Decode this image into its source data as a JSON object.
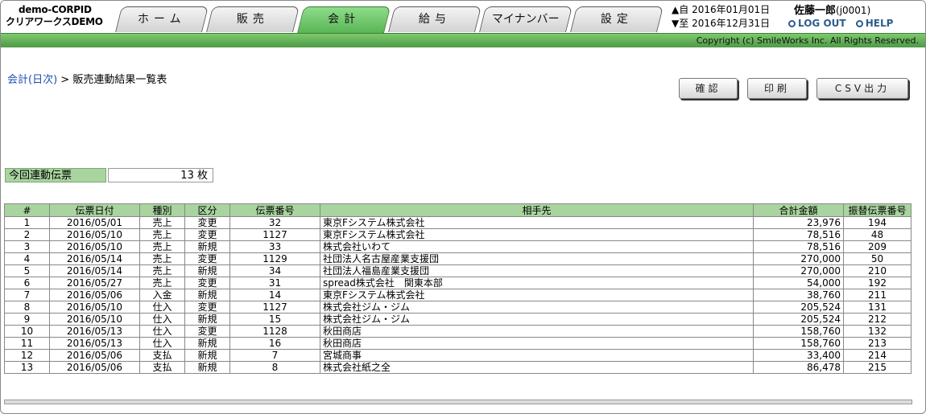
{
  "header": {
    "company_id": "demo-CORPID",
    "company_name": "クリアワークスDEMO",
    "tabs": [
      {
        "label": "ホーム",
        "active": false
      },
      {
        "label": "販売",
        "active": false
      },
      {
        "label": "会計",
        "active": true
      },
      {
        "label": "給与",
        "active": false
      },
      {
        "label": "マイナンバー",
        "active": false
      },
      {
        "label": "設定",
        "active": false
      }
    ],
    "date_from_prefix": "▲自",
    "date_from": "2016年01月01日",
    "date_to_prefix": "▼至",
    "date_to": "2016年12月31日",
    "user_name": "佐藤一郎",
    "user_id": "(j0001)",
    "logout_label": "LOG OUT",
    "help_label": "HELP",
    "copyright": "Copyright (c) SmileWorks Inc. All Rights Reserved."
  },
  "breadcrumb": {
    "parent": "会計(日次)",
    "separator": " > ",
    "current": "販売連動結果一覧表"
  },
  "buttons": {
    "confirm": "確認",
    "print": "印刷",
    "csv": "CSV出力"
  },
  "count": {
    "label": "今回連動伝票",
    "value": "13",
    "unit": "枚"
  },
  "table": {
    "columns": [
      "#",
      "伝票日付",
      "種別",
      "区分",
      "伝票番号",
      "相手先",
      "合計金額",
      "振替伝票番号"
    ],
    "rows": [
      [
        "1",
        "2016/05/01",
        "売上",
        "変更",
        "32",
        "東京Fシステム株式会社",
        "23,976",
        "194"
      ],
      [
        "2",
        "2016/05/10",
        "売上",
        "変更",
        "1127",
        "東京Fシステム株式会社",
        "78,516",
        "48"
      ],
      [
        "3",
        "2016/05/10",
        "売上",
        "新規",
        "33",
        "株式会社いわて",
        "78,516",
        "209"
      ],
      [
        "4",
        "2016/05/14",
        "売上",
        "変更",
        "1129",
        "社団法人名古屋産業支援団",
        "270,000",
        "50"
      ],
      [
        "5",
        "2016/05/14",
        "売上",
        "新規",
        "34",
        "社団法人福島産業支援団",
        "270,000",
        "210"
      ],
      [
        "6",
        "2016/05/27",
        "売上",
        "変更",
        "31",
        "spread株式会社　関東本部",
        "54,000",
        "192"
      ],
      [
        "7",
        "2016/05/06",
        "入金",
        "新規",
        "14",
        "東京Fシステム株式会社",
        "38,760",
        "211"
      ],
      [
        "8",
        "2016/05/10",
        "仕入",
        "変更",
        "1127",
        "株式会社ジム・ジム",
        "205,524",
        "131"
      ],
      [
        "9",
        "2016/05/10",
        "仕入",
        "新規",
        "15",
        "株式会社ジム・ジム",
        "205,524",
        "212"
      ],
      [
        "10",
        "2016/05/13",
        "仕入",
        "変更",
        "1128",
        "秋田商店",
        "158,760",
        "132"
      ],
      [
        "11",
        "2016/05/13",
        "仕入",
        "新規",
        "16",
        "秋田商店",
        "158,760",
        "213"
      ],
      [
        "12",
        "2016/05/06",
        "支払",
        "新規",
        "7",
        "宮城商事",
        "33,400",
        "214"
      ],
      [
        "13",
        "2016/05/06",
        "支払",
        "新規",
        "8",
        "株式会社紙之全",
        "86,478",
        "215"
      ]
    ]
  },
  "colors": {
    "accent_green": "#58b454",
    "header_cell": "#a9d49f",
    "link_blue": "#1b4fb3"
  }
}
